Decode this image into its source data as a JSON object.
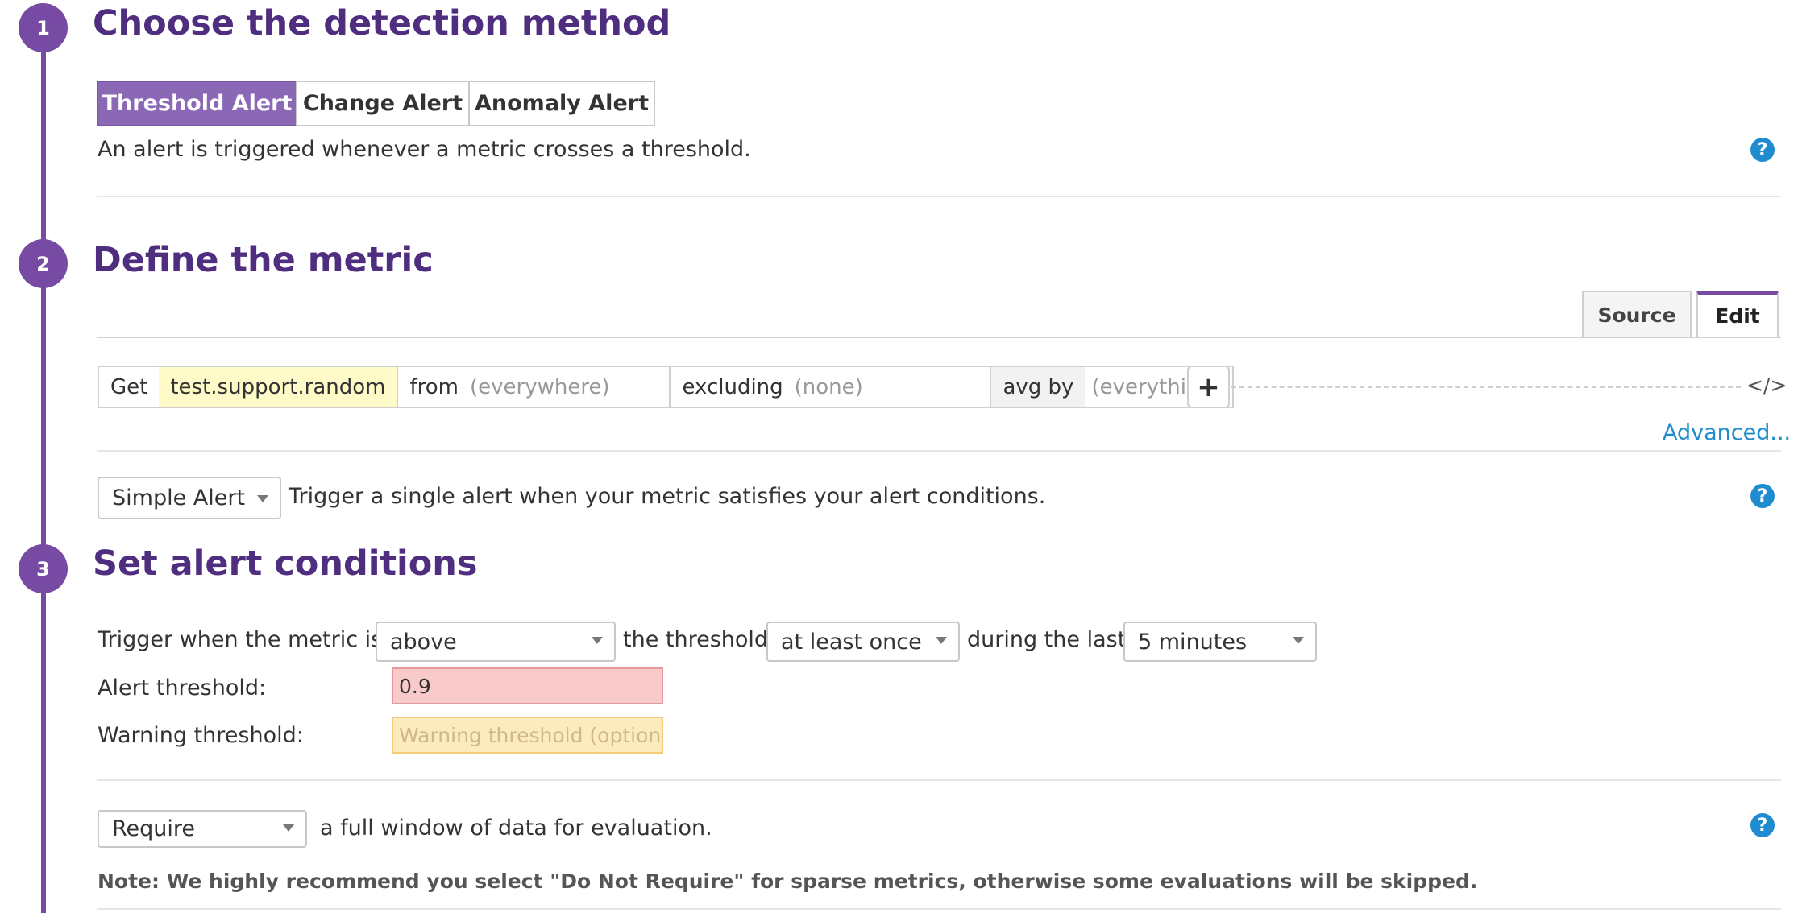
{
  "steps": [
    {
      "number": "1",
      "title": "Choose the detection method"
    },
    {
      "number": "2",
      "title": "Define the metric"
    },
    {
      "number": "3",
      "title": "Set alert conditions"
    }
  ],
  "detection": {
    "options": [
      "Threshold Alert",
      "Change Alert",
      "Anomaly Alert"
    ],
    "selected": "Threshold Alert",
    "description": "An alert is triggered whenever a metric crosses a threshold."
  },
  "metric": {
    "tabs": [
      "Source",
      "Edit"
    ],
    "active_tab": "Edit",
    "query": {
      "get_label": "Get",
      "metric_name": "test.support.random",
      "from_label": "from",
      "from_value": "(everywhere)",
      "excluding_label": "excluding",
      "excluding_value": "(none)",
      "avg_label": "avg by",
      "avg_value": "(everything)"
    },
    "add_label": "+",
    "code_label": "</>",
    "advanced_link": "Advanced..."
  },
  "alert_type": {
    "selected": "Simple Alert",
    "description": "Trigger a single alert when your metric satisfies your alert conditions."
  },
  "conditions": {
    "trigger_label": "Trigger when the metric is",
    "comparator": "above",
    "threshold_label": "the threshold",
    "frequency": "at least once",
    "during_label": "during the last",
    "timeframe": "5 minutes",
    "alert_threshold_label": "Alert threshold:",
    "alert_threshold_value": "0.9",
    "warning_threshold_label": "Warning threshold:",
    "warning_threshold_placeholder": "Warning threshold (optiona"
  },
  "data_window": {
    "selected": "Require",
    "description": "a full window of data for evaluation.",
    "note": "Note: We highly recommend you select \"Do Not Require\" for sparse metrics, otherwise some evaluations will be skipped."
  },
  "help_icon_label": "?",
  "colors": {
    "accent": "#774aa4",
    "title": "#4f2d7f",
    "link": "#1f8cd0",
    "alert_bg": "#f8caca",
    "warning_bg": "#fdebc0"
  }
}
